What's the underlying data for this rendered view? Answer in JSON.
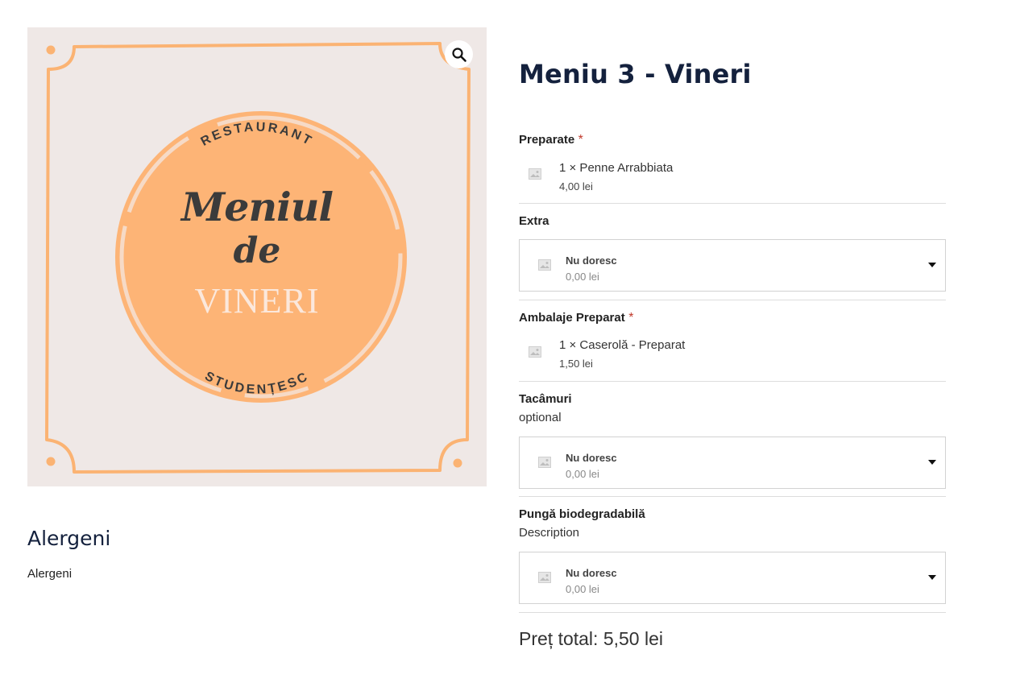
{
  "logo": {
    "top_text": "RESTAURANT",
    "line1": "Meniul",
    "line2": "de",
    "line3": "VINERI",
    "bottom_text": "STUDENȚESC",
    "colors": {
      "background": "#efe8e6",
      "circle": "#fdb476",
      "frame": "#fbb373",
      "dark_text": "#3b3b3b",
      "light_text": "#fbe8dc"
    }
  },
  "zoom_icon": "magnifier-icon",
  "product": {
    "title": "Meniu 3 - Vineri"
  },
  "alergeni": {
    "title": "Alergeni",
    "text": "Alergeni"
  },
  "sections": {
    "preparate": {
      "label": "Preparate",
      "required": "*",
      "item_name": "1 × Penne Arrabbiata",
      "item_price": "4,00 lei"
    },
    "extra": {
      "label": "Extra",
      "option_name": "Nu doresc",
      "option_price": "0,00 lei"
    },
    "ambalaje": {
      "label": "Ambalaje Preparat",
      "required": "*",
      "item_name": "1 × Caserolă - Preparat",
      "item_price": "1,50 lei"
    },
    "tacamuri": {
      "label": "Tacâmuri",
      "description": "optional",
      "option_name": "Nu doresc",
      "option_price": "0,00 lei"
    },
    "punga": {
      "label": "Pungă biodegradabilă",
      "description": "Description",
      "option_name": "Nu doresc",
      "option_price": "0,00 lei"
    }
  },
  "total": {
    "text": "Preț total: 5,50 lei"
  },
  "colors": {
    "title": "#14213d",
    "required": "#c0392b",
    "divider": "#dddddd"
  }
}
